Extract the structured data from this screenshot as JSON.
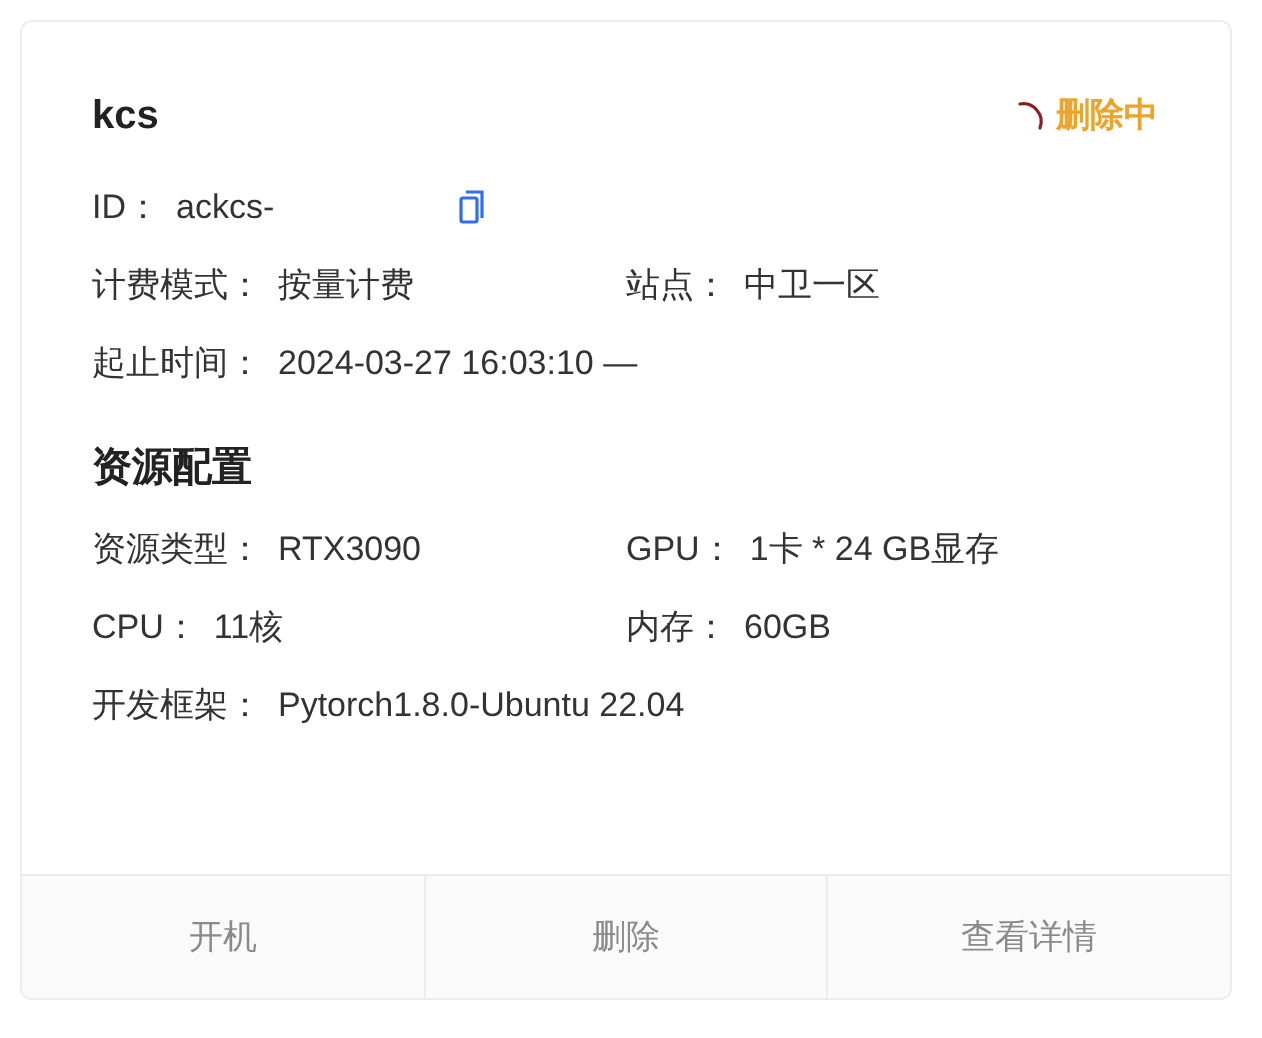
{
  "card": {
    "title": "kcs",
    "status": {
      "kind": "deleting",
      "text": "删除中"
    },
    "id": {
      "label": "ID：",
      "value": "ackcs-"
    },
    "info_rows": [
      [
        {
          "label": "计费模式：",
          "value": "按量计费"
        },
        {
          "label": "站点：",
          "value": "中卫一区"
        }
      ],
      [
        {
          "label": "起止时间：",
          "value": "2024-03-27 16:03:10 —"
        }
      ]
    ],
    "section_title": "资源配置",
    "resource_rows": [
      [
        {
          "label": "资源类型：",
          "value": "RTX3090"
        },
        {
          "label": "GPU：",
          "value": "1卡 * 24 GB显存"
        }
      ],
      [
        {
          "label": "CPU：",
          "value": "11核"
        },
        {
          "label": "内存：",
          "value": "60GB"
        }
      ],
      [
        {
          "label": "开发框架：",
          "value": "Pytorch1.8.0-Ubuntu 22.04"
        }
      ]
    ],
    "actions": [
      {
        "label": "开机",
        "disabled": true
      },
      {
        "label": "删除",
        "disabled": true
      },
      {
        "label": "查看详情",
        "disabled": true
      }
    ]
  }
}
